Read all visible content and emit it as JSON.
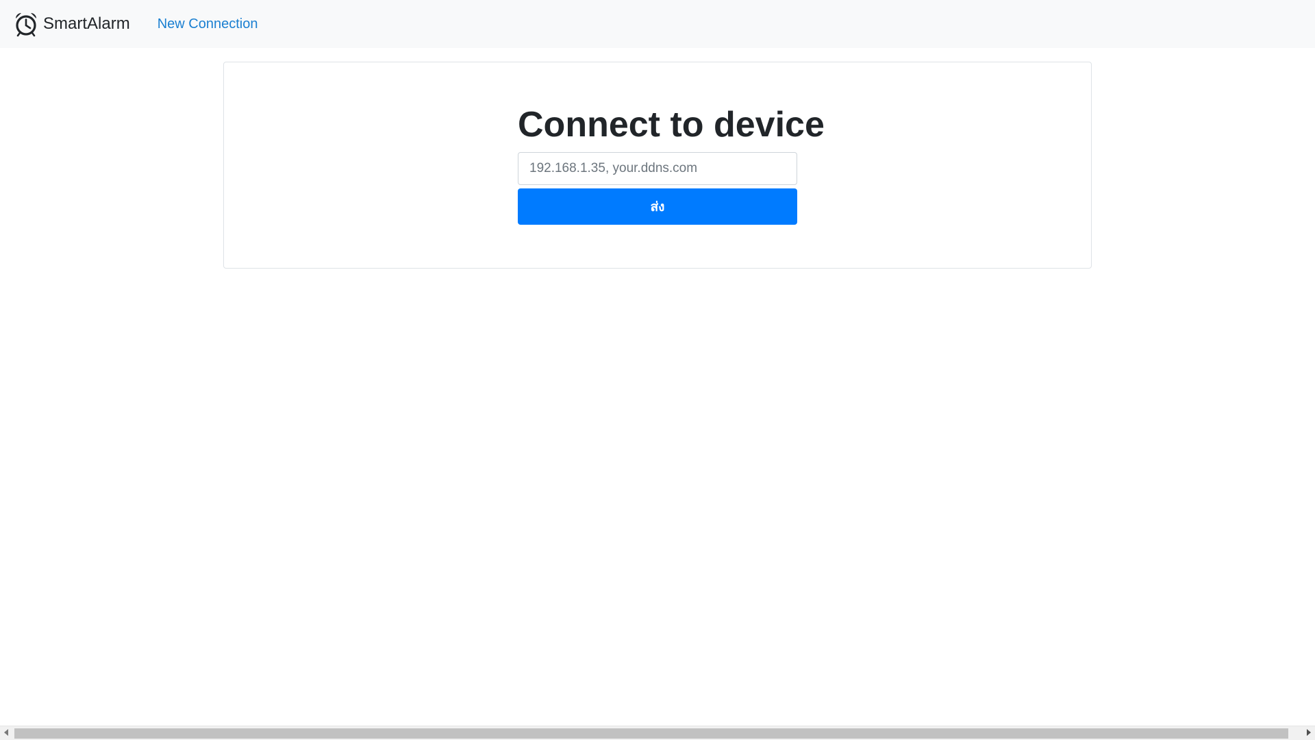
{
  "navbar": {
    "brand_icon": "alarm-clock-icon",
    "brand_label": "SmartAlarm",
    "nav_link_label": "New Connection"
  },
  "connect_form": {
    "title": "Connect to device",
    "address_placeholder": "192.168.1.35, your.ddns.com",
    "address_value": "",
    "submit_label": "ส่ง"
  },
  "colors": {
    "navbar_bg": "#f8f9fa",
    "link": "#1a7fd1",
    "primary_button": "#007bff",
    "card_border": "#dee2e6"
  }
}
